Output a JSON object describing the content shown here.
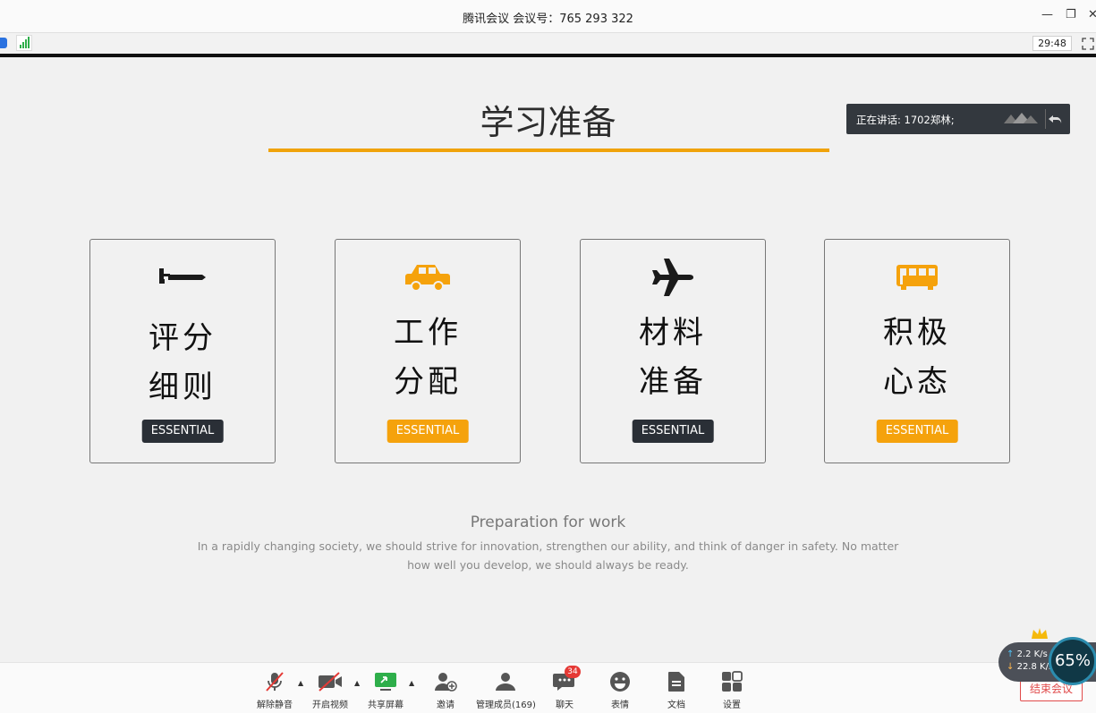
{
  "window": {
    "title": "腾讯会议 会议号：765 293 322",
    "minimize": "—",
    "restore": "❐",
    "close": "✕"
  },
  "status": {
    "timer": "29:48"
  },
  "slide": {
    "title": "学习准备",
    "cards": [
      {
        "line1": "评分",
        "line2": "细则",
        "badge": "ESSENTIAL",
        "icon": "submarine-icon"
      },
      {
        "line1": "工作",
        "line2": "分配",
        "badge": "ESSENTIAL",
        "icon": "car-icon"
      },
      {
        "line1": "材料",
        "line2": "准备",
        "badge": "ESSENTIAL",
        "icon": "airplane-icon"
      },
      {
        "line1": "积极",
        "line2": "心态",
        "badge": "ESSENTIAL",
        "icon": "bus-icon"
      }
    ],
    "subtitle": "Preparation for work",
    "text": "In a rapidly changing society, we should strive for innovation, strengthen our ability, and think of danger in safety. No matter how well you develop, we should always be ready."
  },
  "speaker": {
    "label": "正在讲话: 1702郑林;"
  },
  "toolbar": {
    "unmute": "解除静音",
    "video": "开启视频",
    "share": "共享屏幕",
    "invite": "邀请",
    "members": "管理成员(169)",
    "chat": "聊天",
    "chat_badge": "34",
    "emoji": "表情",
    "docs": "文档",
    "settings": "设置"
  },
  "end_button": "结束会议",
  "network": {
    "up": "2.2 K/s",
    "down": "22.8 K/s",
    "percent": "65%"
  },
  "colors": {
    "accent": "#f0a30a",
    "dark_badge": "#2a2f36",
    "orange_badge": "#f5a20c",
    "end": "#e04a4a"
  }
}
